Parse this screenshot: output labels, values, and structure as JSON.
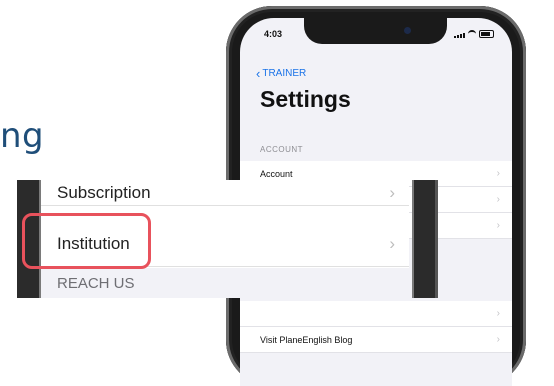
{
  "heading_fragment": "ng",
  "phone": {
    "status_time": "4:03",
    "back_label": "TRAINER",
    "title": "Settings",
    "account_section": "ACCOUNT",
    "rows": [
      {
        "label": "Account"
      },
      {
        "label": ""
      },
      {
        "label": ""
      }
    ],
    "bottom_rows": [
      {
        "label": ""
      },
      {
        "label": "Visit PlaneEnglish Blog"
      }
    ]
  },
  "zoom": {
    "subscription_label": "Subscription",
    "institution_label": "Institution",
    "reach_section": "REACH US"
  },
  "colors": {
    "heading": "#1f4e79",
    "accent": "#1a73e8",
    "highlight": "#e8525c"
  }
}
